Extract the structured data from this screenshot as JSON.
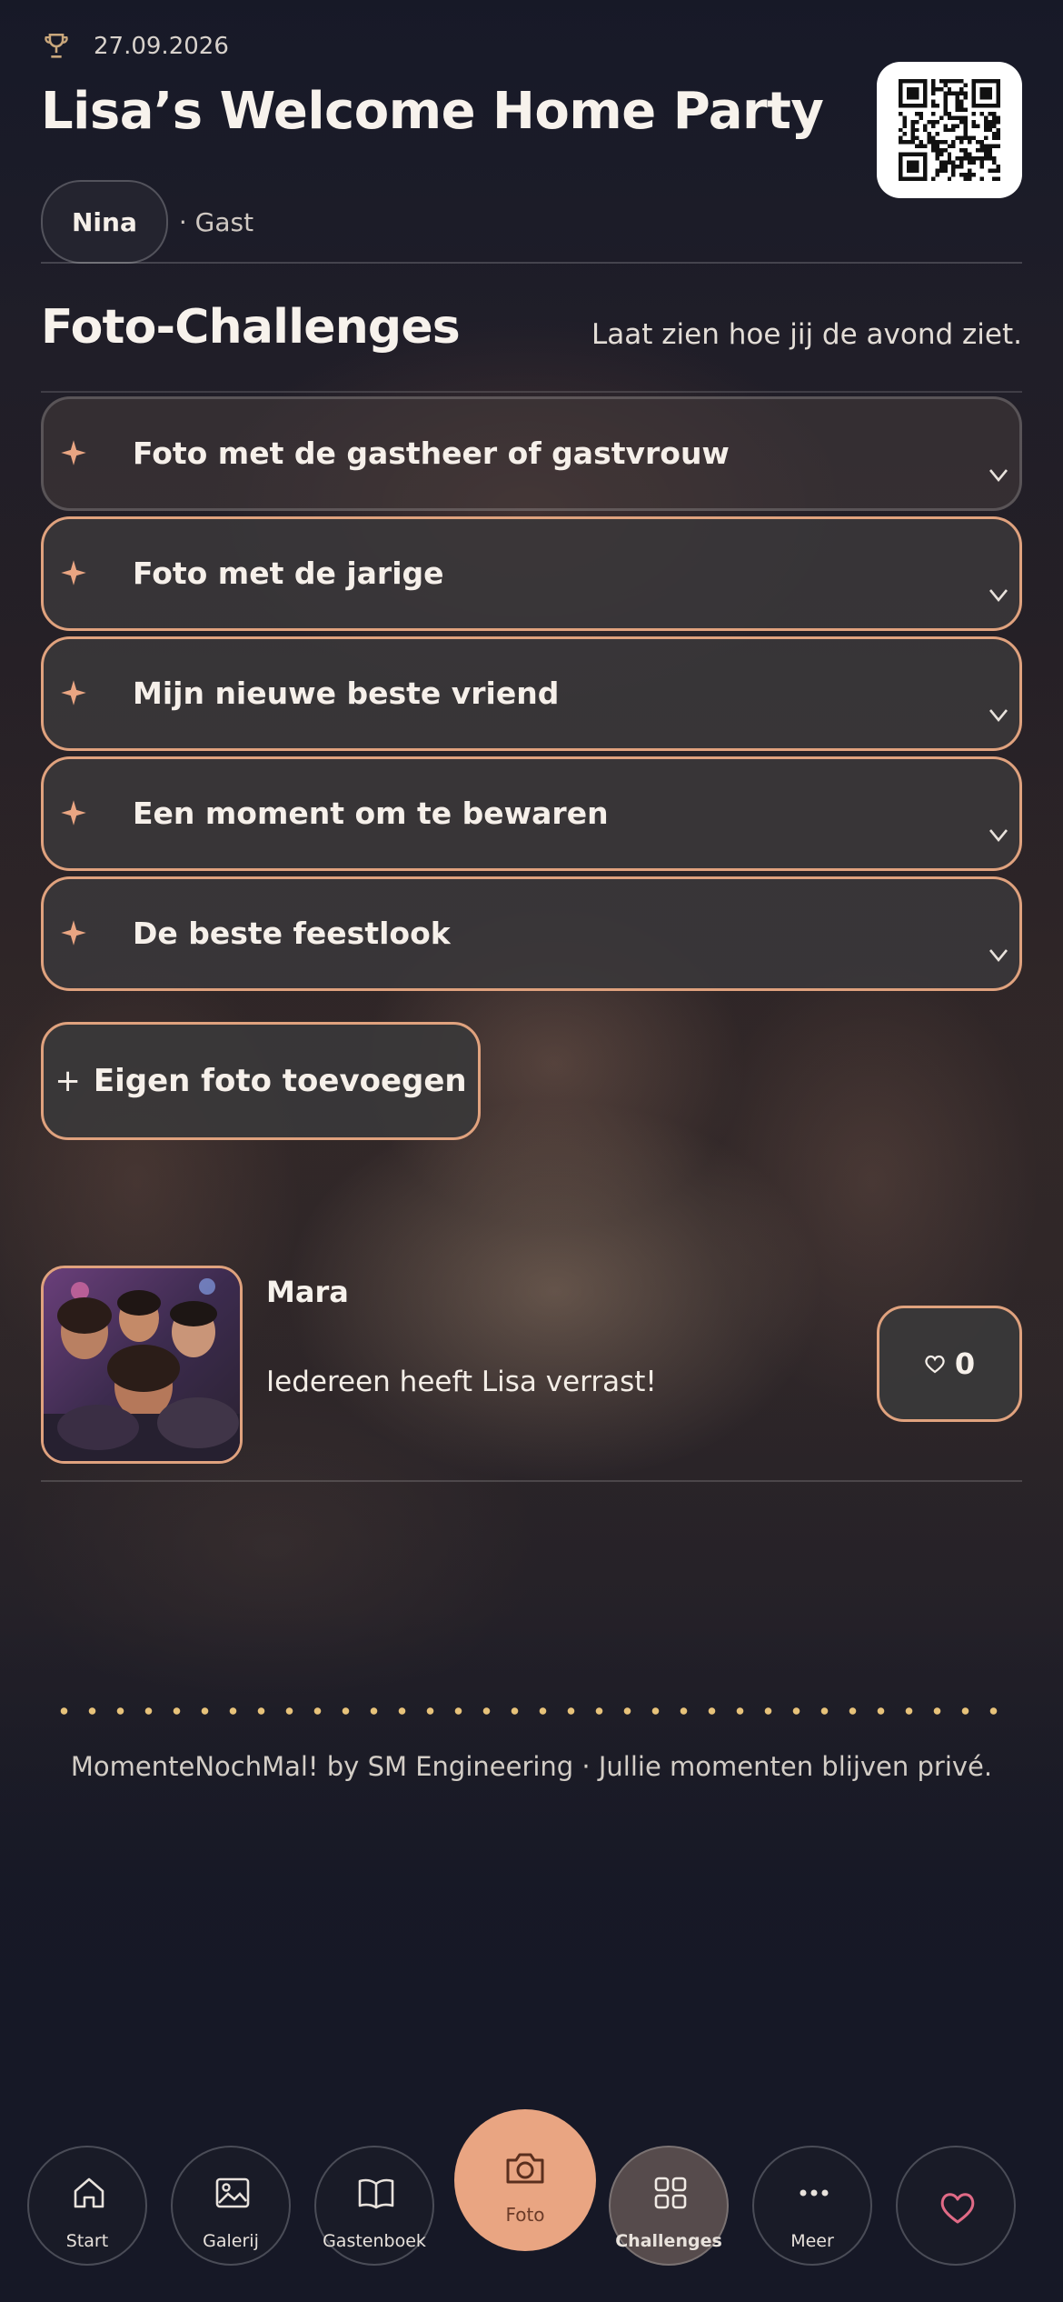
{
  "header": {
    "date": "27.09.2026",
    "title": "Lisa’s Welcome Home Party",
    "user_name": "Nina",
    "role": "· Gast"
  },
  "section": {
    "title": "Foto-Challenges",
    "subtitle": "Laat zien hoe jij de avond ziet."
  },
  "challenges": [
    {
      "label": "Foto met de gastheer of gastvrouw"
    },
    {
      "label": "Foto met de jarige"
    },
    {
      "label": "Mijn nieuwe beste vriend"
    },
    {
      "label": "Een moment om te bewaren"
    },
    {
      "label": "De beste feestlook"
    }
  ],
  "add_button": {
    "icon": "+",
    "label": "Eigen foto toevoegen"
  },
  "post": {
    "author": "Mara",
    "text": "Iedereen heeft Lisa verrast!",
    "likes": "0"
  },
  "footer": "MomenteNochMal! by SM Engineering · Jullie momenten blijven privé.",
  "nav": [
    {
      "label": "Start",
      "icon": "home-icon"
    },
    {
      "label": "Galerij",
      "icon": "image-icon"
    },
    {
      "label": "Gastenboek",
      "icon": "book-icon"
    },
    {
      "label": "Foto",
      "icon": "camera-icon"
    },
    {
      "label": "Challenges",
      "icon": "grid-icon"
    },
    {
      "label": "Meer",
      "icon": "more-icon"
    },
    {
      "label": "",
      "icon": "heart-icon"
    }
  ],
  "colors": {
    "accent": "#e9a582",
    "border_accent": "#e0a27e",
    "background": "#1a1c2a"
  }
}
